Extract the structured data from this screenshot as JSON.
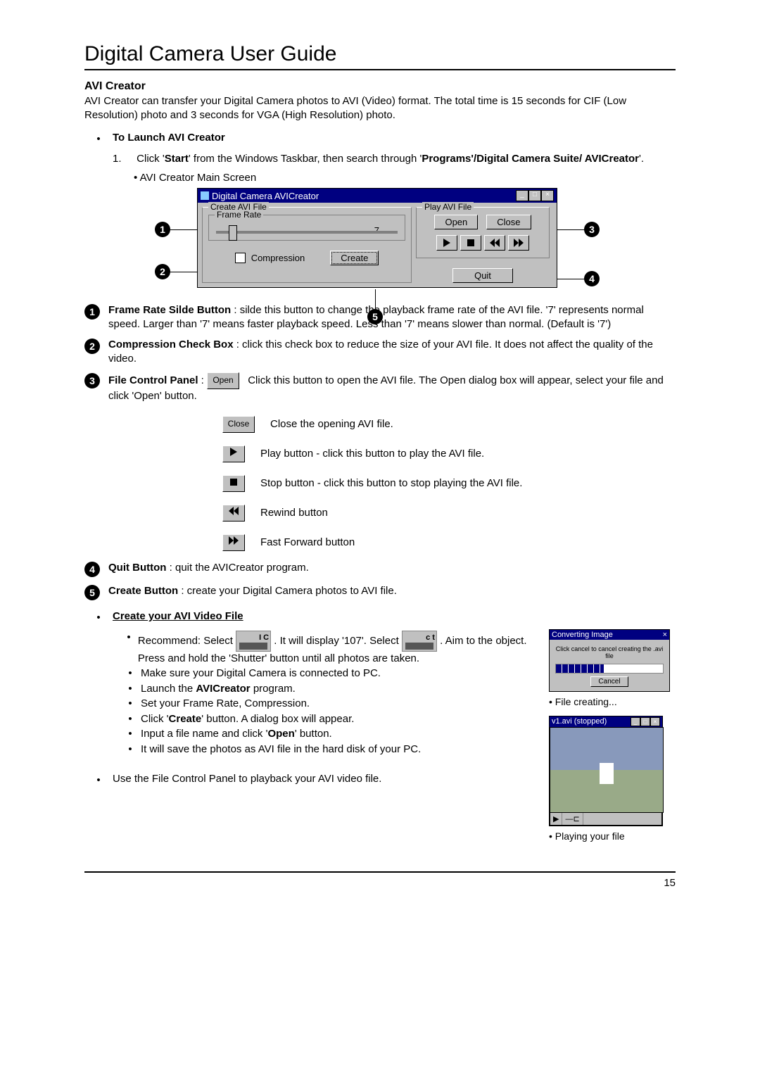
{
  "header": {
    "title": "Digital Camera User Guide"
  },
  "section1": {
    "heading": "AVI Creator",
    "intro": "AVI Creator can transfer your Digital Camera photos to AVI (Video) format. The total time is 15 seconds for CIF (Low Resolution) photo and 3 seconds for VGA (High Resolution) photo."
  },
  "launch": {
    "heading": "To Launch AVI Creator",
    "step_prefix": "1.",
    "step_part1": "Click '",
    "step_bold1": "Start",
    "step_part2": "' from the Windows Taskbar, then search through '",
    "step_bold2": "Programs'/Digital Camera Suite/ AVICreator",
    "step_part3": "'.",
    "caption": "• AVI Creator Main Screen"
  },
  "window": {
    "title": "Digital Camera AVICreator",
    "group_create": "Create AVI File",
    "group_framerate": "Frame Rate",
    "framerate_value": "7",
    "compression": "Compression",
    "create_btn": "Create",
    "group_play": "Play AVI File",
    "open_btn": "Open",
    "close_btn": "Close",
    "quit_btn": "Quit"
  },
  "callouts": {
    "c1": "1",
    "c2": "2",
    "c3": "3",
    "c4": "4",
    "c5": "5"
  },
  "annotations": {
    "a1_bold": "Frame Rate Silde Button",
    "a1_body": " : silde this button to change the playback frame rate of the AVI file.  '7' represents normal speed. Larger than '7' means faster playback speed. Less than '7' means slower than normal. (Default is '7')",
    "a2_bold": "Compression Check Box",
    "a2_body": " : click this check box to reduce the size of your AVI file. It does not affect the quality of the video.",
    "a3_bold": "File Control Panel",
    "a3_colon": " : ",
    "a3_open_label": "Open",
    "a3_open_text": "Click this button to open the AVI file. The Open dialog box will appear, select your file and click 'Open' button.",
    "a3_close_label": "Close",
    "a3_close_text": "Close the opening AVI file.",
    "a3_play_text": "Play button - click this button to play the AVI file.",
    "a3_stop_text": "Stop button - click this button to stop playing the AVI file.",
    "a3_rewind_text": "Rewind button",
    "a3_ff_text": "Fast Forward button",
    "a4_bold": "Quit Button",
    "a4_body": " : quit the AVICreator program.",
    "a5_bold": "Create Button",
    "a5_body": " : create your Digital Camera photos to AVI file."
  },
  "create_section": {
    "heading": "Create your AVI Video File",
    "rec_prefix": "Recommend: Select ",
    "rec_mark1": "107",
    "rec_mid": ". It will display '107'. Select ",
    "rec_suffix": " . Aim  to the object. Press and hold the 'Shutter' button until all photos are taken.",
    "li2": "Make sure your Digital Camera is connected to PC.",
    "li3_a": "Launch the ",
    "li3_bold": "AVICreator",
    "li3_b": " program.",
    "li4": "Set your Frame Rate, Compression.",
    "li5_a": "Click '",
    "li5_bold": "Create",
    "li5_b": "' button. A dialog box will appear.",
    "li6_a": "Input a file name and click '",
    "li6_bold": "Open",
    "li6_b": "' button.",
    "li7": "It will save the photos as AVI file in the hard disk of your PC."
  },
  "playback_line": "Use the File Control Panel to playback your AVI video file.",
  "thumbs": {
    "t1_title": "Converting Image",
    "t1_msg": "Click cancel to cancel creating the .avi file",
    "t1_cancel": "Cancel",
    "t1_cap": "• File creating...",
    "t2_title": "v1.avi (stopped)",
    "t2_cap": "• Playing your file"
  },
  "page_number": "15"
}
